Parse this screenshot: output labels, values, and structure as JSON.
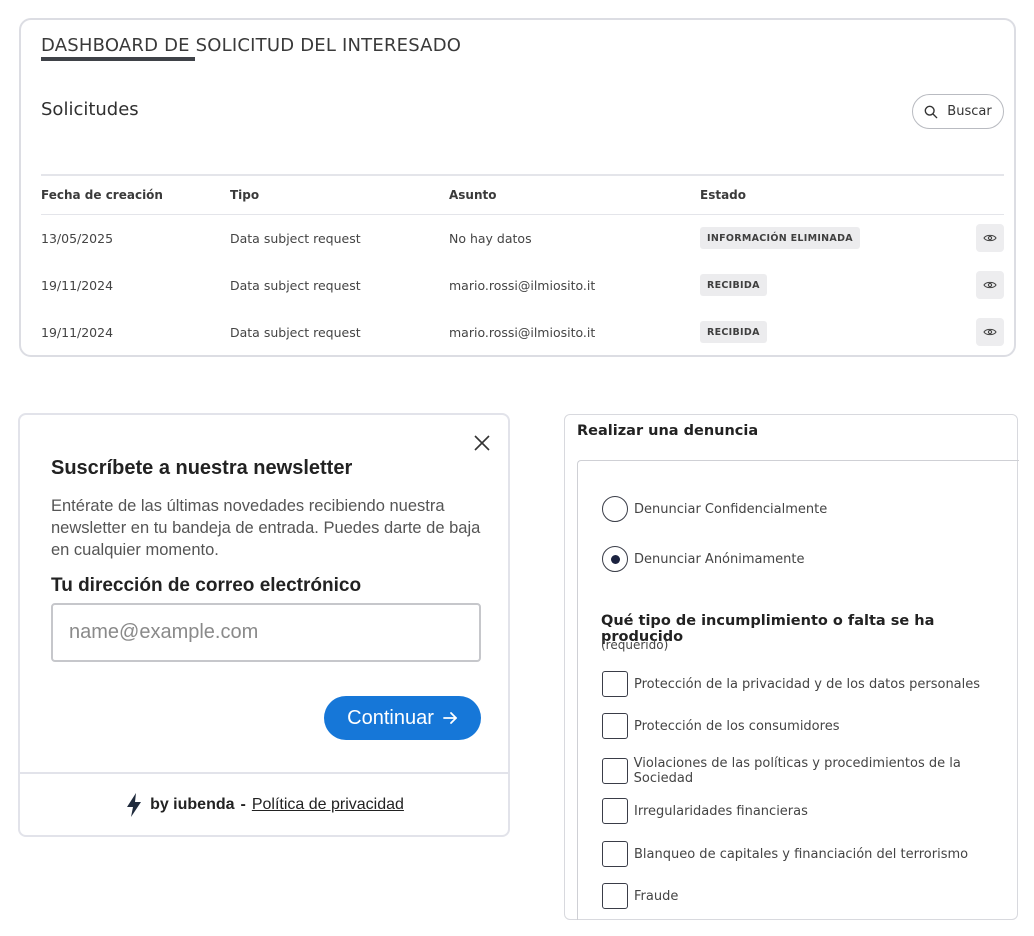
{
  "dashboard": {
    "title": "DASHBOARD DE SOLICITUD DEL INTERESADO",
    "subtitle": "Solicitudes",
    "search_label": "Buscar",
    "columns": [
      "Fecha de creación",
      "Tipo",
      "Asunto",
      "Estado"
    ],
    "rows": [
      {
        "date": "13/05/2025",
        "type": "Data subject request",
        "subject": "No hay datos",
        "status": "INFORMACIÓN ELIMINADA"
      },
      {
        "date": "19/11/2024",
        "type": "Data subject request",
        "subject": "mario.rossi@ilmiosito.it",
        "status": "RECIBIDA"
      },
      {
        "date": "19/11/2024",
        "type": "Data subject request",
        "subject": "mario.rossi@ilmiosito.it",
        "status": "RECIBIDA"
      }
    ],
    "row_action_icon": "eye-icon"
  },
  "newsletter": {
    "title": "Suscríbete a nuestra newsletter",
    "description": "Entérate de las últimas novedades recibiendo nuestra newsletter en tu bandeja de entrada. Puedes darte de baja en cualquier momento.",
    "email_label": "Tu dirección de correo electrónico",
    "email_placeholder": "name@example.com",
    "email_value": "",
    "continue_label": "Continuar",
    "footer_by": "by iubenda",
    "footer_sep": "-",
    "footer_link": "Política de privacidad",
    "accent_color": "#1677d8"
  },
  "report": {
    "title": "Realizar una denuncia",
    "options": [
      {
        "label": "Denunciar Confidencialmente",
        "selected": false
      },
      {
        "label": "Denunciar Anónimamente",
        "selected": true
      }
    ],
    "question": "Qué tipo de incumplimiento o falta se ha producido",
    "required_note": "(requerido)",
    "checkboxes": [
      "Protección de la privacidad y de los datos personales",
      "Protección de los consumidores",
      "Violaciones de las políticas y procedimientos de la Sociedad",
      "Irregularidades financieras",
      "Blanqueo de capitales y financiación del terrorismo",
      "Fraude"
    ]
  }
}
